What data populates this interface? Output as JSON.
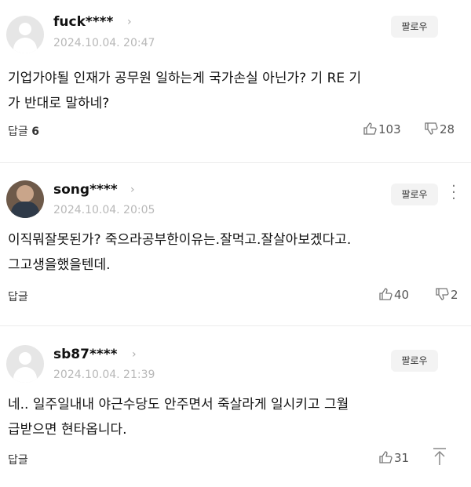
{
  "comments": [
    {
      "username": "fuck****",
      "date": "2024.10.04. 20:47",
      "follow_label": "팔로우",
      "content_line1": "기업가야될 인재가 공무원 일하는게 국가손실 아닌가? 기 RE 기",
      "content_line2": "가 반대로 말하네?",
      "reply_label": "답글",
      "reply_count": "6",
      "like_count": "103",
      "dislike_count": "28",
      "avatar": "default-avatar-icon"
    },
    {
      "username": "song****",
      "date": "2024.10.04. 20:05",
      "follow_label": "팔로우",
      "content_line1": "이직뭐잘못된가? 죽으라공부한이유는.잘먹고.잘살아보겠다고.",
      "content_line2": "그고생을했을텐데.",
      "reply_label": "답글",
      "reply_count": "",
      "like_count": "40",
      "dislike_count": "2",
      "avatar": "profile-photo"
    },
    {
      "username": "sb87****",
      "date": "2024.10.04. 21:39",
      "follow_label": "팔로우",
      "content_line1": "네.. 일주일내내 야근수당도 안주면서 죽살라게 일시키고 그월",
      "content_line2": "급받으면 현타옵니다.",
      "reply_label": "답글",
      "reply_count": "",
      "like_count": "31",
      "dislike_count": "",
      "avatar": "default-avatar-icon"
    }
  ],
  "icons": {
    "like": "thumbs-up-icon",
    "dislike": "thumbs-down-icon",
    "scroll_top": "arrow-up-icon",
    "more": "more-vertical-icon"
  }
}
